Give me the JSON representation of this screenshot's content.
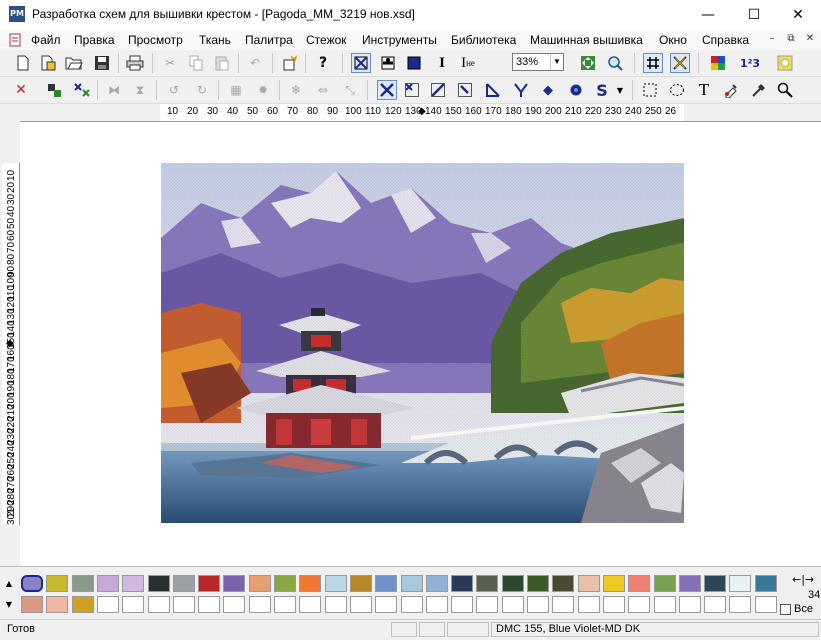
{
  "window": {
    "app_icon_text": "PM",
    "title": "Разработка схем для вышивки крестом - [Pagoda_MM_3219 нов.xsd]",
    "minimize_glyph": "—",
    "maximize_glyph": "☐",
    "close_glyph": "✕"
  },
  "menu": {
    "items": [
      "Файл",
      "Правка",
      "Просмотр",
      "Ткань",
      "Палитра",
      "Стежок",
      "Инструменты",
      "Библиотека",
      "Машинная вышивка",
      "Окно",
      "Справка"
    ],
    "mdi_minimize": "–",
    "mdi_restore": "⧉",
    "mdi_close": "✕"
  },
  "toolbar1": {
    "icons": [
      "new-file-icon",
      "open-template-icon",
      "open-folder-icon",
      "save-icon",
      "print-icon",
      "cut-icon",
      "copy-icon",
      "paste-icon",
      "undo-icon",
      "insert-icon",
      "help-icon",
      "full-cross-icon",
      "half-stitch-icon",
      "filled-square-icon",
      "text-cursor-icon",
      "text-tool-icon",
      "zoom-select",
      "fit-icon",
      "zoom-icon",
      "grid-icon",
      "cross-grid-icon",
      "palette-icon",
      "numbering-icon",
      "highlight-icon"
    ],
    "zoom_value": "33%",
    "help_glyph": "?",
    "text_glyph": "I",
    "text_tool_glyph": "I",
    "numbering_glyph": "1²3"
  },
  "toolbar2": {
    "icons": [
      "delete-icon",
      "move-icon",
      "cut-selection-icon",
      "mirror-h-icon",
      "mirror-v-icon",
      "rotate-left-icon",
      "rotate-right-icon",
      "dither-icon",
      "fill-icon",
      "snow-icon",
      "flip-icon",
      "scale-icon",
      "cross-stitch-icon",
      "quarter-stitch-icon",
      "three-quarter-stitch-icon",
      "backstitch-icon",
      "long-stitch-icon",
      "fork-stitch-icon",
      "bead-icon",
      "french-knot-icon",
      "special-stitch-icon",
      "rect-select-icon",
      "lasso-icon",
      "text-insert-icon",
      "color-picker-icon",
      "eyedropper-icon",
      "magnifier-icon"
    ],
    "special_glyph": "S",
    "text_insert_glyph": "T"
  },
  "ruler_h": {
    "labels": [
      "10",
      "20",
      "30",
      "40",
      "50",
      "60",
      "70",
      "80",
      "90",
      "100",
      "110",
      "120",
      "130",
      "140",
      "150",
      "160",
      "170",
      "180",
      "190",
      "200",
      "210",
      "220",
      "230",
      "240",
      "250",
      "26"
    ]
  },
  "ruler_v": {
    "labels": [
      "10",
      "20",
      "30",
      "40",
      "50",
      "60",
      "70",
      "80",
      "90",
      "100",
      "110",
      "120",
      "130",
      "140",
      "150",
      "160",
      "170",
      "180",
      "190",
      "200",
      "210",
      "220",
      "230",
      "240",
      "250",
      "260",
      "270",
      "280",
      "290",
      "301"
    ]
  },
  "palette": {
    "row1": [
      "#8a82c8",
      "#c8b830",
      "#8a9a8a",
      "#c8a8d8",
      "#d0b8e0",
      "#2a3030",
      "#9aa0a4",
      "#b82828",
      "#7a62b0",
      "#e8a070",
      "#8aa840",
      "#f07830",
      "#b8d8e8",
      "#b88828",
      "#6e92c8",
      "#a8c8e0",
      "#90b0d8",
      "#283858",
      "#5a6050",
      "#2a4a30",
      "#3a5a28",
      "#4a4a30",
      "#e8c0a8",
      "#f0c820",
      "#f08070",
      "#78a050",
      "#8870b8",
      "#2a4858",
      "#e8f0f0",
      "#3a7898"
    ],
    "row2": [
      "#d89a80",
      "#f0b8a0",
      "#d0a020",
      "#ffffff",
      "#ffffff",
      "#ffffff",
      "#ffffff",
      "#ffffff",
      "#ffffff",
      "#ffffff",
      "#ffffff",
      "#ffffff",
      "#ffffff",
      "#ffffff",
      "#ffffff",
      "#ffffff",
      "#ffffff",
      "#ffffff",
      "#ffffff",
      "#ffffff",
      "#ffffff",
      "#ffffff",
      "#ffffff",
      "#ffffff",
      "#ffffff",
      "#ffffff",
      "#ffffff",
      "#ffffff",
      "#ffffff",
      "#ffffff"
    ],
    "selected_index": 0,
    "count": "34",
    "all_label": "Все",
    "arrows": "←|→"
  },
  "status": {
    "ready": "Готов",
    "thread": "DMC  155, Blue Violet-MD DK"
  }
}
